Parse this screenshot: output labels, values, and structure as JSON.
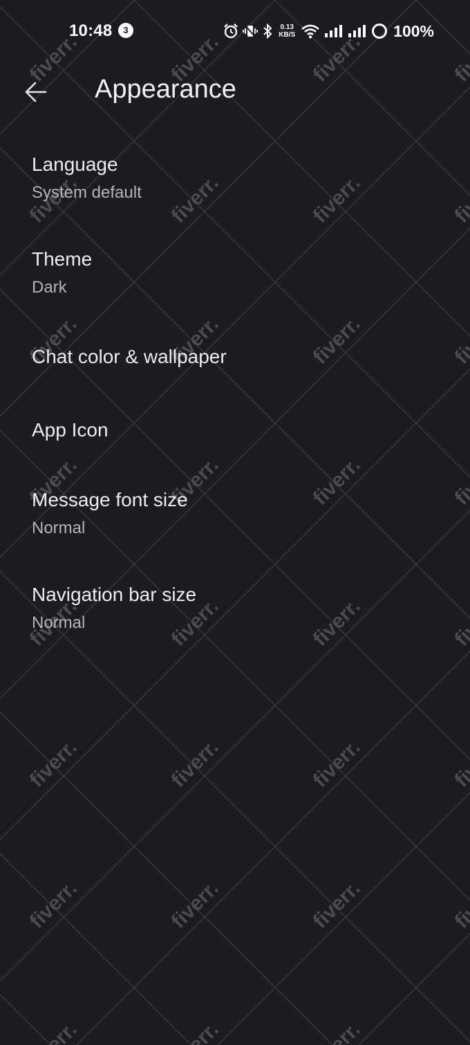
{
  "status_bar": {
    "time": "10:48",
    "notification_count": "3",
    "net_speed_value": "0.13",
    "net_speed_unit": "KB/S",
    "battery": "100%",
    "icons": [
      "alarm-icon",
      "vibrate-icon",
      "bluetooth-icon",
      "wifi-icon",
      "signal-icon",
      "signal-icon",
      "battery-ring-icon"
    ]
  },
  "header": {
    "title": "Appearance",
    "back_icon": "arrow-left-icon"
  },
  "settings": [
    {
      "title": "Language",
      "subtitle": "System default"
    },
    {
      "title": "Theme",
      "subtitle": "Dark"
    },
    {
      "title": "Chat color & wallpaper"
    },
    {
      "title": "App Icon"
    },
    {
      "title": "Message font size",
      "subtitle": "Normal"
    },
    {
      "title": "Navigation bar size",
      "subtitle": "Normal"
    }
  ],
  "watermark": "fiverr.",
  "colors": {
    "background": "#1b1c20",
    "text_primary": "#eeeef0",
    "text_secondary": "#b4b5ba"
  }
}
